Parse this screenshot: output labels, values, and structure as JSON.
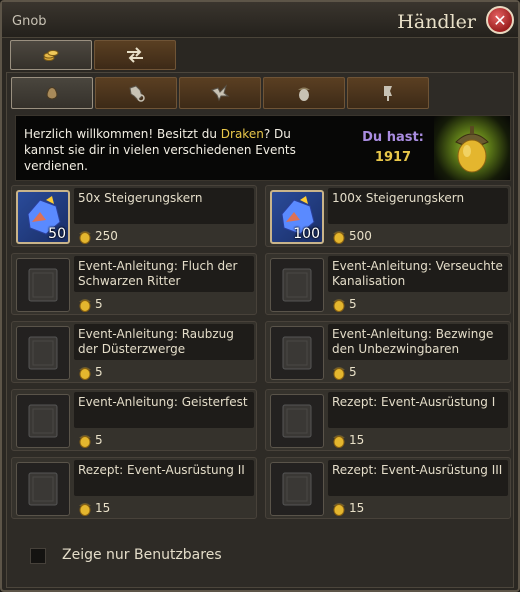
{
  "window": {
    "title_left": "Gnob",
    "title_right": "Händler"
  },
  "top_tabs": [
    {
      "icon": "coins-icon"
    },
    {
      "icon": "swap-arrows-icon"
    }
  ],
  "sub_tabs": [
    {
      "icon": "pouch-icon"
    },
    {
      "icon": "horse-icon"
    },
    {
      "icon": "griffin-icon"
    },
    {
      "icon": "acorn-icon"
    },
    {
      "icon": "banner-icon"
    }
  ],
  "welcome": {
    "part1": "Herzlich willkommen! Besitzt du ",
    "highlight": "Draken",
    "part2": "? Du kannst sie dir in vielen verschiedenen Events verdienen.",
    "du_hast_label": "Du hast:",
    "du_hast_value": "1917"
  },
  "items": [
    {
      "name": "50x Steigerungskern",
      "price": "250",
      "icon": "gem-icon",
      "count": "50"
    },
    {
      "name": "100x Steigerungskern",
      "price": "500",
      "icon": "gem-icon",
      "count": "100"
    },
    {
      "name": "Event-Anleitung: Fluch der Schwarzen Ritter",
      "price": "5",
      "icon": "book-icon",
      "count": ""
    },
    {
      "name": "Event-Anleitung: Verseuchte Kanalisation",
      "price": "5",
      "icon": "book-icon",
      "count": ""
    },
    {
      "name": "Event-Anleitung: Raubzug der Düsterzwerge",
      "price": "5",
      "icon": "book-icon",
      "count": ""
    },
    {
      "name": "Event-Anleitung: Bezwinge den Unbezwingbaren",
      "price": "5",
      "icon": "book-icon",
      "count": ""
    },
    {
      "name": "Event-Anleitung: Geisterfest",
      "price": "5",
      "icon": "book-icon",
      "count": ""
    },
    {
      "name": "Rezept: Event-Ausrüstung I",
      "price": "15",
      "icon": "book-icon",
      "count": ""
    },
    {
      "name": "Rezept: Event-Ausrüstung II",
      "price": "15",
      "icon": "book-icon",
      "count": ""
    },
    {
      "name": "Rezept: Event-Ausrüstung III",
      "price": "15",
      "icon": "book-icon",
      "count": ""
    }
  ],
  "footer": {
    "checkbox_label": "Zeige nur Benutzbares"
  },
  "colors": {
    "accent": "#e8c74a",
    "du_hast": "#a98ce0",
    "close": "#b02a2a"
  }
}
